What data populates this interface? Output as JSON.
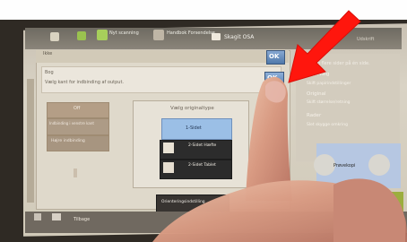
{
  "topbar": {
    "item1": "Ikke",
    "item2": "Nyt\nscanning",
    "item3": "Handbok\nForsendelse",
    "item4": "Skagit OSA",
    "item5": "Udskrift"
  },
  "dialog": {
    "header_text": "Ikke",
    "ok_label": "OK",
    "ok_label_2": "OK",
    "line1": "Bog",
    "line2": "Vælg kant for indbinding af output.",
    "off_label": "Off",
    "left_btn_2": "Indbinding i venstre\nkant",
    "left_btn_3": "Højre indbinding",
    "orientation_title": "Vælg originaltype",
    "options": [
      "1-Sidet",
      "2-Sidet\nHæfte",
      "2-Sidet\nTablet"
    ],
    "orientation_button": "Orienteringsindstilling"
  },
  "right_panel": {
    "line1": "Vælg flere sider på én side.",
    "line2": "Papirvalg",
    "line3": "Skift papirindstillinger",
    "line4": "Original",
    "line5": "Skift størrelse/retning",
    "line6": "Rader",
    "line7": "Slet skygge omkring",
    "preview_label": "Prøvekopi"
  },
  "bottom_bar": {
    "item1": "Tilbage"
  },
  "colors": {
    "wall": "#ffffff",
    "bezel": "#38322b",
    "screen": "#d8d2c4",
    "accent_arrow": "#ff1a0f",
    "ok_blue": "#5e87b9",
    "skin": "#d99e86"
  }
}
